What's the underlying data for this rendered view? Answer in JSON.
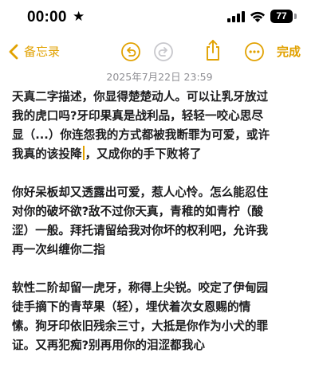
{
  "status_bar": {
    "time": "00:00",
    "focus_icon": "star-icon",
    "signal_icon": "cellular-signal-icon",
    "wifi_icon": "wifi-icon",
    "battery_level": "77"
  },
  "nav": {
    "back_label": "备忘录",
    "done_label": "完成",
    "icons": [
      "chevron-left-icon",
      "undo-icon",
      "redo-icon",
      "share-icon",
      "more-icon"
    ],
    "accent_color": "#e1a100"
  },
  "note": {
    "date": "2025年7月22日 23:59",
    "paragraph_1": [
      "天真二字描述，你显得楚楚动人。可以让乳牙放过",
      "我的虎口吗?牙印果真是战利品，轻轻一咬心思尽",
      "显（...）你连怨我的方式都被我断罪为可爱，或许",
      "我真的该投降",
      "，又成你的手下败将了"
    ],
    "paragraph_2": [
      "你好呆板却又透露出可爱，惹人心怜。怎么能忍住",
      "对你的破坏欲?敌不过你天真，青稚的如青柠（酸",
      "涩）一般。拜托请留给我对你坏的权利吧，允许我",
      "再一次纠缠你二指"
    ],
    "paragraph_3": [
      "软性二阶却留一虎牙，称得上尖锐。咬定了伊甸园",
      "徒手摘下的青苹果（轻），埋伏着次女恩赐的情",
      "愫。狗牙印依旧残余三寸，大抵是你作为小犬的罪",
      "证。又再犯痴?别再用你的泪涩都我心"
    ]
  }
}
